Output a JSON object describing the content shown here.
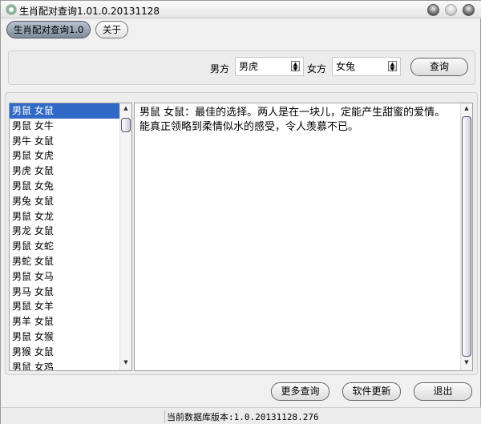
{
  "window": {
    "title": "生肖配对查询1.01.0.20131128",
    "icon": "gear-icon",
    "controls": [
      "minimize",
      "maximize",
      "close"
    ]
  },
  "tabs": [
    {
      "label": "生肖配对查询1.0",
      "active": true
    },
    {
      "label": "关于",
      "active": false
    }
  ],
  "query": {
    "male_label": "男方",
    "male_value": "男虎",
    "female_label": "女方",
    "female_value": "女兔",
    "query_button": "查询"
  },
  "list": {
    "items": [
      "男鼠 女鼠",
      "男鼠 女牛",
      "男牛 女鼠",
      "男鼠 女虎",
      "男虎 女鼠",
      "男鼠 女兔",
      "男兔 女鼠",
      "男鼠 女龙",
      "男龙 女鼠",
      "男鼠 女蛇",
      "男蛇 女鼠",
      "男鼠 女马",
      "男马 女鼠",
      "男鼠 女羊",
      "男羊 女鼠",
      "男鼠 女猴",
      "男猴 女鼠",
      "男鼠 女鸡"
    ],
    "selected_index": 0
  },
  "detail": {
    "text": "男鼠 女鼠：最佳的选择。两人是在一块儿，定能产生甜蜜的爱情。能真正领略到柔情似水的感受，令人羡慕不已。"
  },
  "buttons": {
    "more": "更多查询",
    "update": "软件更新",
    "exit": "退出"
  },
  "status": {
    "text": "当前数据库版本:1.0.20131128.276"
  },
  "colors": {
    "selection": "#3169c6"
  }
}
